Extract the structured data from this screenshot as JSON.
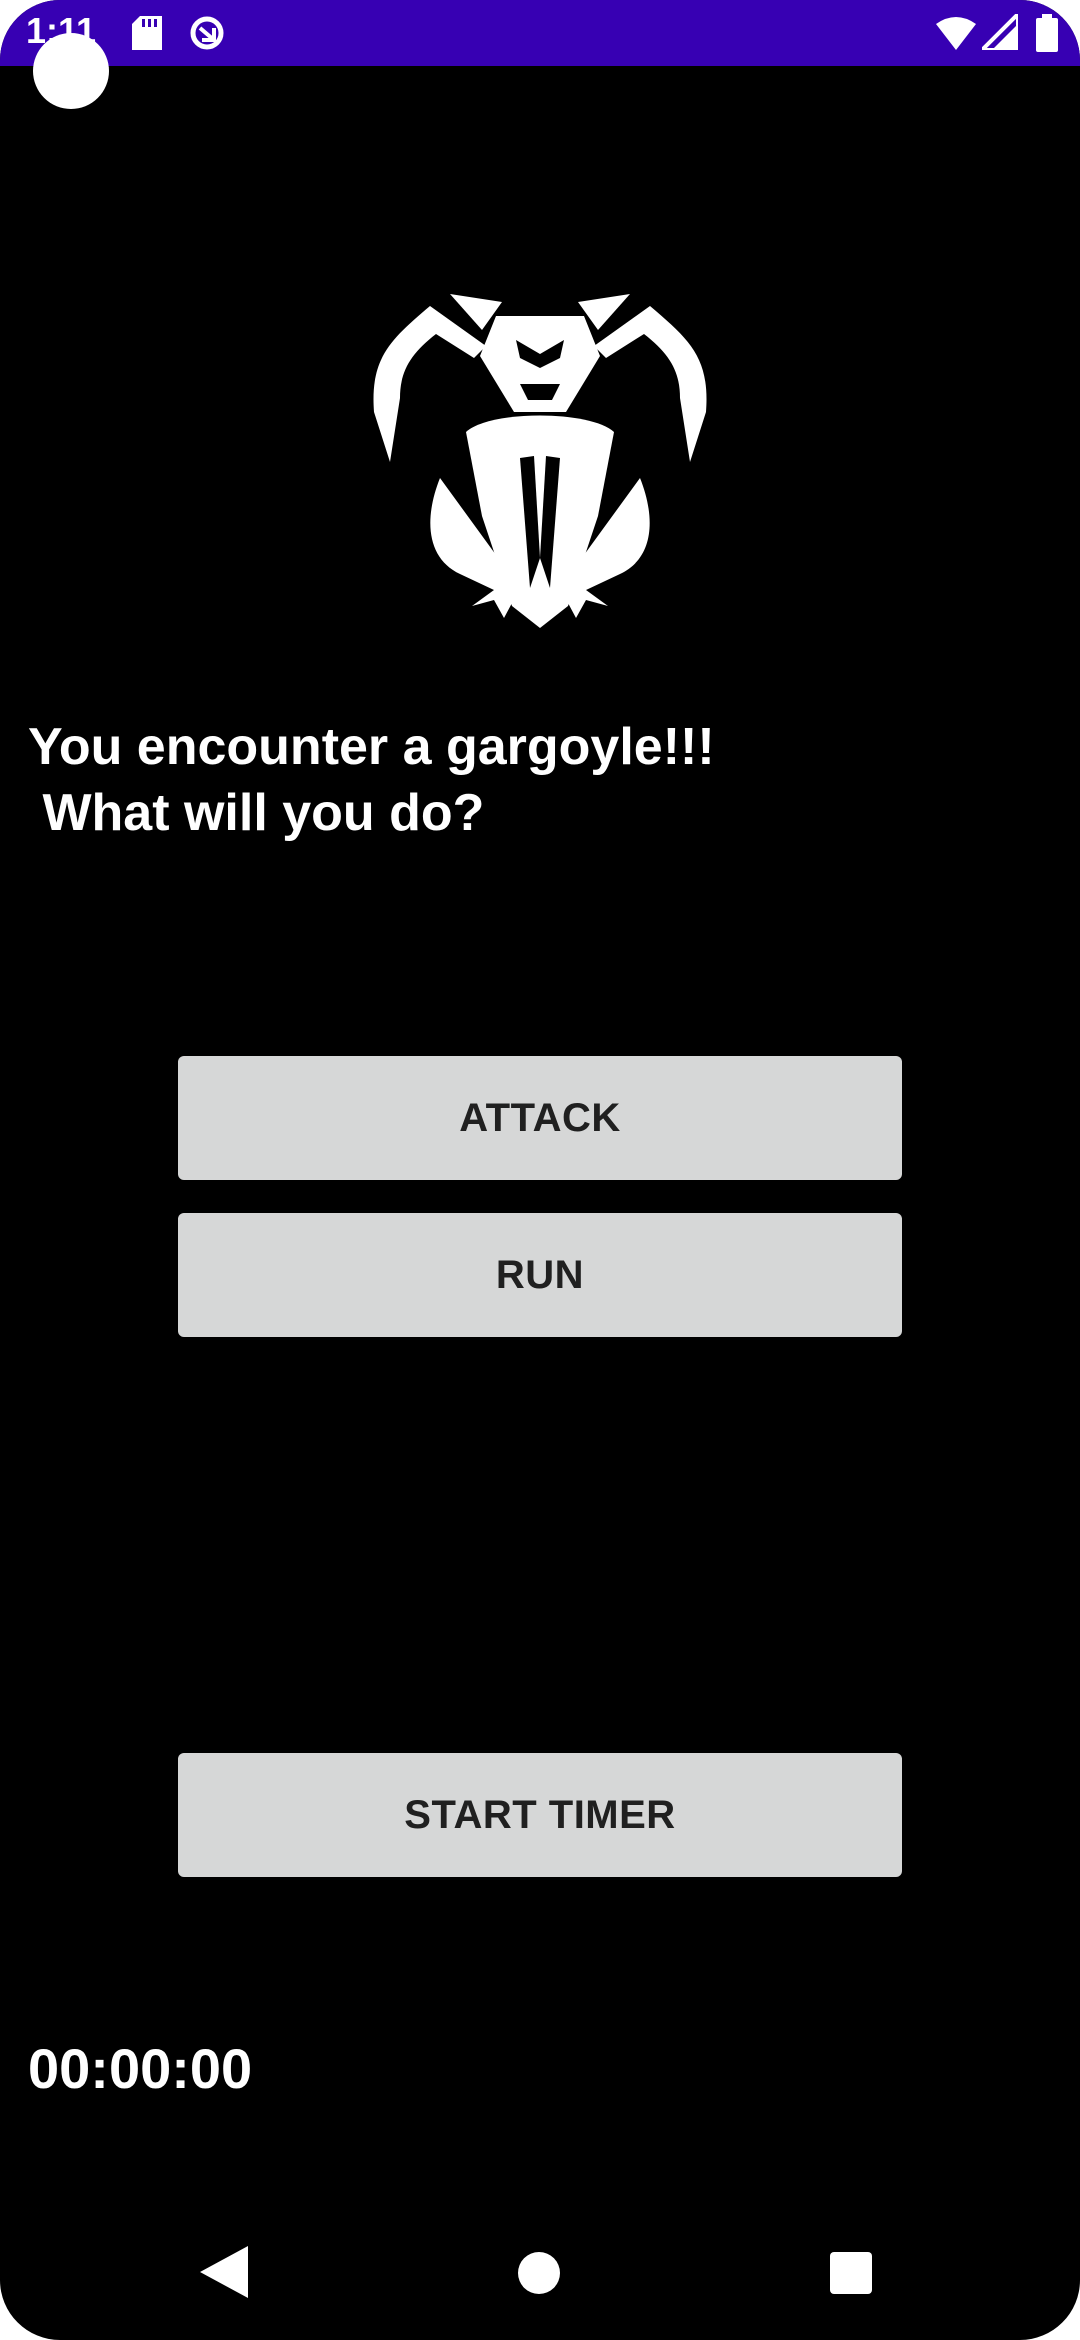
{
  "status_bar": {
    "time": "1:11",
    "color": "#3700b3",
    "icons": [
      "sd-card-icon",
      "sync-icon",
      "wifi-icon",
      "signal-icon",
      "battery-icon"
    ]
  },
  "encounter": {
    "image_icon": "gargoyle-icon",
    "message": "You encounter a gargoyle!!!\n What will you do?"
  },
  "actions": {
    "attack_label": "ATTACK",
    "run_label": "RUN",
    "start_timer_label": "START TIMER"
  },
  "timer": {
    "value": "00:00:00"
  },
  "navigation": {
    "icons": [
      "back-icon",
      "home-icon",
      "recents-icon"
    ]
  }
}
